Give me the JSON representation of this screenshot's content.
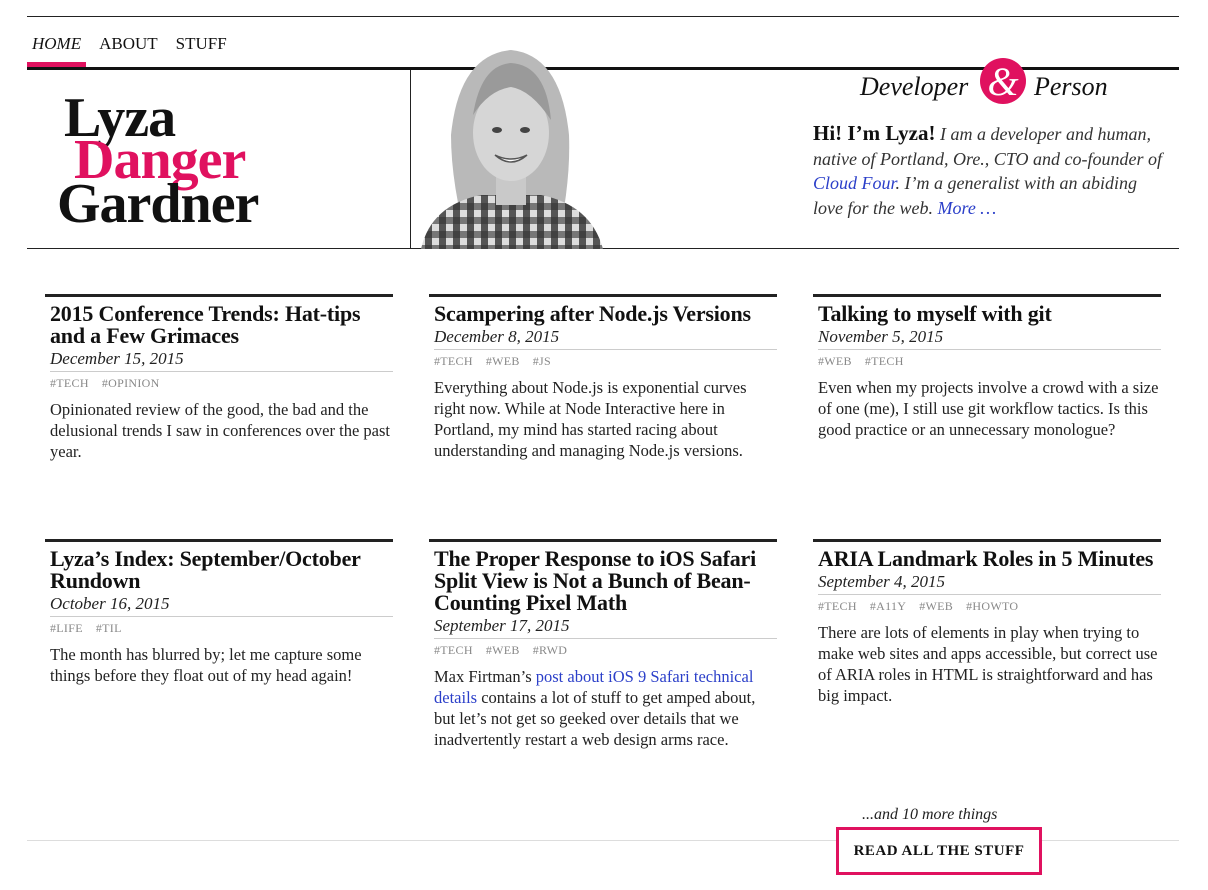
{
  "nav": {
    "home": "HOME",
    "about": "ABOUT",
    "stuff": "STUFF"
  },
  "brand": {
    "first": "Lyza",
    "middle": "Danger",
    "last": "Gardner"
  },
  "tagline": {
    "w1": "Developer",
    "amp": "&",
    "w2": "Person"
  },
  "intro": {
    "greeting": "Hi! I’m Lyza!",
    "t1": " I am a developer and human, native of Portland, Ore., CTO and co-founder of ",
    "link": "Cloud Four",
    "t2": ". I’m a generalist with an abiding love for the web. ",
    "more": "More …"
  },
  "posts": [
    {
      "title": "2015 Conference Trends: Hat-tips and a Few Grimaces",
      "date": "December 15, 2015",
      "tags": [
        "#TECH",
        "#OPINION"
      ],
      "excerpt": "Opinionated review of the good, the bad and the delusional trends I saw in conferences over the past year."
    },
    {
      "title": "Scampering after Node.js Versions",
      "date": "December 8, 2015",
      "tags": [
        "#TECH",
        "#WEB",
        "#JS"
      ],
      "excerpt": "Everything about Node.js is exponential curves right now. While at Node Interactive here in Portland, my mind has started racing about understanding and managing Node.js versions."
    },
    {
      "title": "Talking to myself with git",
      "date": "November 5, 2015",
      "tags": [
        "#WEB",
        "#TECH"
      ],
      "excerpt": "Even when my projects involve a crowd with a size of one (me), I still use git workflow tactics. Is this good practice or an unnecessary monologue?"
    },
    {
      "title": "Lyza’s Index: September/October Rundown",
      "date": "October 16, 2015",
      "tags": [
        "#LIFE",
        "#TIL"
      ],
      "excerpt": "The month has blurred by; let me capture some things before they float out of my head again!"
    },
    {
      "title": "The Proper Response to iOS Safari Split View is Not a Bunch of Bean-Counting Pixel Math",
      "date": "September 17, 2015",
      "tags": [
        "#TECH",
        "#WEB",
        "#RWD"
      ],
      "excerpt_pre": "Max Firtman’s ",
      "excerpt_link": "post about iOS 9 Safari technical details",
      "excerpt_post": " contains a lot of stuff to get amped about, but let’s not get so geeked over details that we inadvertently restart a web design arms race."
    },
    {
      "title": "ARIA Landmark Roles in 5 Minutes",
      "date": "September 4, 2015",
      "tags": [
        "#TECH",
        "#A11Y",
        "#WEB",
        "#HOWTO"
      ],
      "excerpt": "There are lots of elements in play when trying to make web sites and apps accessible, but correct use of ARIA roles in HTML is straightforward and has big impact."
    }
  ],
  "more": {
    "text": "...and 10 more things",
    "button": "READ ALL THE STUFF"
  },
  "colors": {
    "accent": "#e0115f",
    "link": "#2b3fc9"
  }
}
